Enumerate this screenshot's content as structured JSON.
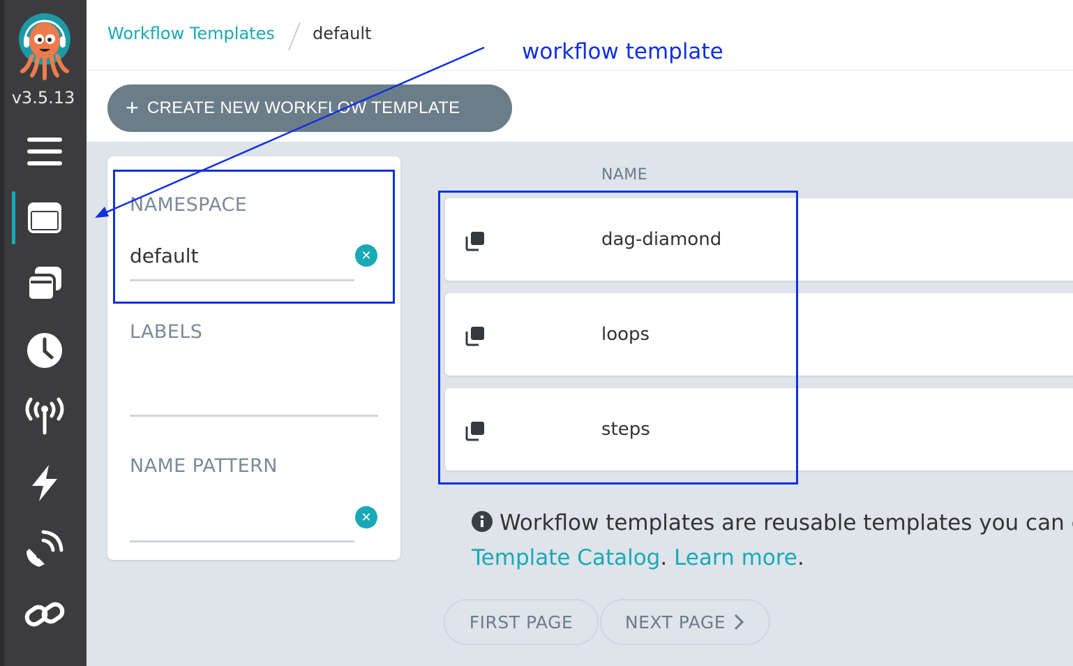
{
  "app": {
    "version": "v3.5.13"
  },
  "sidebar": {
    "items": [
      {
        "name": "menu-icon"
      },
      {
        "name": "workflow-templates-icon",
        "active": true
      },
      {
        "name": "cluster-templates-icon"
      },
      {
        "name": "cron-workflows-icon"
      },
      {
        "name": "event-sources-icon"
      },
      {
        "name": "sensors-icon"
      },
      {
        "name": "event-flow-icon"
      },
      {
        "name": "link-icon"
      }
    ]
  },
  "breadcrumb": {
    "parent": "Workflow Templates",
    "current": "default"
  },
  "toolbar": {
    "create_label": "CREATE NEW WORKFLOW TEMPLATE",
    "create_icon": "+"
  },
  "filters": {
    "namespace": {
      "label": "NAMESPACE",
      "value": "default"
    },
    "labels": {
      "label": "LABELS",
      "value": ""
    },
    "name_pattern": {
      "label": "NAME PATTERN",
      "value": ""
    }
  },
  "table": {
    "column": "NAME",
    "rows": [
      {
        "name": "dag-diamond"
      },
      {
        "name": "loops"
      },
      {
        "name": "steps"
      }
    ]
  },
  "info": {
    "text": "Workflow templates are reusable templates you can cre",
    "link1": "Template Catalog",
    "sep": ". ",
    "link2": "Learn more",
    "end": "."
  },
  "pagination": {
    "first_label": "FIRST PAGE",
    "next_label": "NEXT PAGE"
  },
  "annotation": {
    "label": "workflow template",
    "color": "#1030e0"
  },
  "colors": {
    "accent": "#18a9b5",
    "sidebar": "#3c3c3e",
    "button": "#6b7d89",
    "background": "#dee4ea"
  }
}
